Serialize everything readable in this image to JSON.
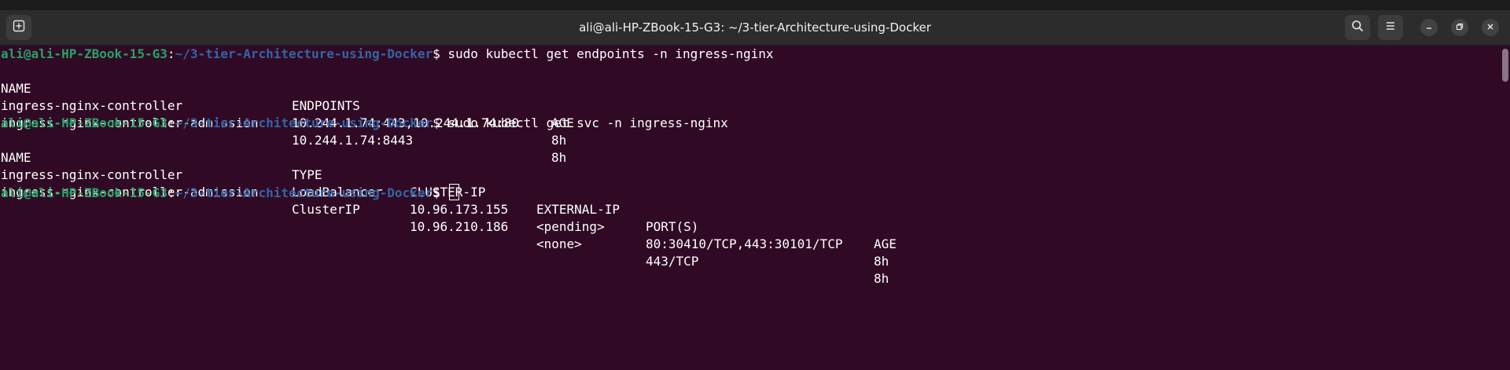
{
  "window": {
    "title": "ali@ali-HP-ZBook-15-G3: ~/3-tier-Architecture-using-Docker"
  },
  "icons": {
    "new_tab": "new-tab-icon",
    "search": "search-icon",
    "menu": "hamburger-menu-icon",
    "minimize": "minimize-icon",
    "maximize": "restore-icon",
    "close": "close-icon"
  },
  "colors": {
    "terminal_bg": "#300a24",
    "prompt_user": "#26a269",
    "prompt_path": "#3465a4",
    "titlebar_bg": "#2c2c2c"
  },
  "terminal": {
    "prompt": {
      "user": "ali@ali-HP-ZBook-15-G3",
      "colon": ":",
      "path": "~/3-tier-Architecture-using-Docker",
      "symbol": "$ "
    },
    "commands": [
      "sudo kubectl get endpoints -n ingress-nginx",
      "sudo kubectl get svc -n ingress-nginx"
    ],
    "endpoints_table": {
      "headers": [
        "NAME",
        "ENDPOINTS",
        "AGE"
      ],
      "rows": [
        [
          "ingress-nginx-controller",
          "10.244.1.74:443,10.244.1.74:80",
          "8h"
        ],
        [
          "ingress-nginx-controller-admission",
          "10.244.1.74:8443",
          "8h"
        ]
      ]
    },
    "svc_table": {
      "headers": [
        "NAME",
        "TYPE",
        "CLUSTER-IP",
        "EXTERNAL-IP",
        "PORT(S)",
        "AGE"
      ],
      "rows": [
        [
          "ingress-nginx-controller",
          "LoadBalancer",
          "10.96.173.155",
          "<pending>",
          "80:30410/TCP,443:30101/TCP",
          "8h"
        ],
        [
          "ingress-nginx-controller-admission",
          "ClusterIP",
          "10.96.210.186",
          "<none>",
          "443/TCP",
          "8h"
        ]
      ]
    }
  }
}
